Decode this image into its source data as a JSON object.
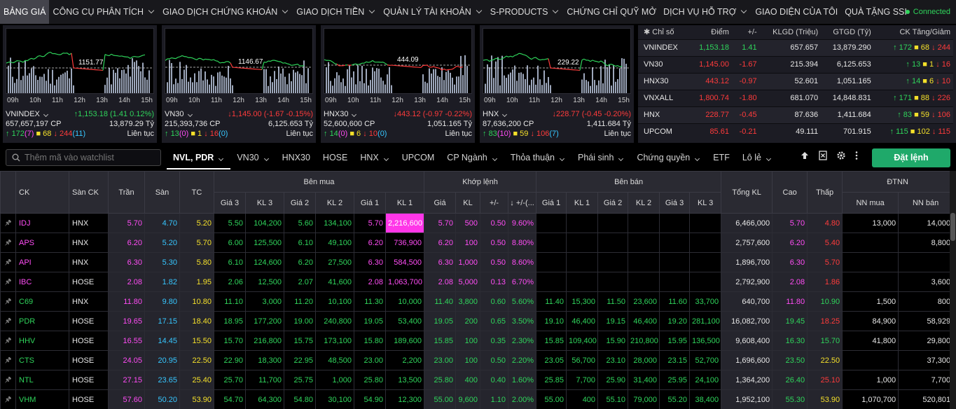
{
  "nav": {
    "items": [
      {
        "label": "BẢNG GIÁ",
        "active": true,
        "chev": false
      },
      {
        "label": "CÔNG CỤ PHÂN TÍCH",
        "chev": true
      },
      {
        "label": "GIAO DỊCH CHỨNG KHOÁN",
        "chev": true
      },
      {
        "label": "GIAO DỊCH TIỀN",
        "chev": true
      },
      {
        "label": "QUẢN LÝ TÀI KHOẢN",
        "chev": true
      },
      {
        "label": "S-PRODUCTS",
        "chev": true
      },
      {
        "label": "CHỨNG CHỈ QUỸ MỞ",
        "chev": false
      },
      {
        "label": "DỊCH VỤ HỖ TRỢ",
        "chev": true
      },
      {
        "label": "GIAO DIỆN CỦA TÔI",
        "chev": false
      },
      {
        "label": "QUÀ TẶNG SSI",
        "chev": false
      }
    ],
    "status": "Connected"
  },
  "xticks": [
    "09h",
    "10h",
    "11h",
    "12h",
    "13h",
    "14h",
    "15h"
  ],
  "panels": [
    {
      "ref_label": "1151.77",
      "name": "VNINDEX",
      "value": "1,153.18",
      "change": "(1.41 0.12%)",
      "dir": "up",
      "volume": "657,657,197 CP",
      "amount": "13,879.29 Tỷ",
      "adv": "172",
      "adv_c": "(7)",
      "nc": "68",
      "dec": "244",
      "dec_c": "(11)",
      "session": "Liên tục"
    },
    {
      "ref_label": "1146.67",
      "name": "VN30",
      "value": "1,145.00",
      "change": "(-1.67 -0.15%)",
      "dir": "dn",
      "volume": "215,393,736 CP",
      "amount": "6,125.653 Tỷ",
      "adv": "13",
      "adv_c": "(0)",
      "nc": "1",
      "dec": "16",
      "dec_c": "(0)",
      "session": "Liên tục"
    },
    {
      "ref_label": "444.09",
      "name": "HNX30",
      "value": "443.12",
      "change": "(-0.97 -0.22%)",
      "dir": "dn",
      "volume": "52,600,600 CP",
      "amount": "1,051.165 Tỷ",
      "adv": "14",
      "adv_c": "(0)",
      "nc": "6",
      "dec": "10",
      "dec_c": "(0)",
      "session": "Liên tục"
    },
    {
      "ref_label": "229.22",
      "name": "HNX",
      "value": "228.77",
      "change": "(-0.45 -0.20%)",
      "dir": "dn",
      "volume": "87,636,200 CP",
      "amount": "1,411.684 Tỷ",
      "adv": "83",
      "adv_c": "(10)",
      "nc": "59",
      "dec": "106",
      "dec_c": "(7)",
      "session": "Liên tục"
    }
  ],
  "index_table": {
    "headers": [
      "Chỉ số",
      "Điểm",
      "+/-",
      "KLGD (Triệu)",
      "GTGD (Tỷ)",
      "CK Tăng/Giảm"
    ],
    "rows": [
      {
        "name": "VNINDEX",
        "point": "1,153.18",
        "chg": "1.41",
        "vol": "657.657",
        "val": "13,879.290",
        "adv": "172",
        "nc": "68",
        "dec": "244",
        "dir": "up"
      },
      {
        "name": "VN30",
        "point": "1,145.00",
        "chg": "-1.67",
        "vol": "215.394",
        "val": "6,125.653",
        "adv": "13",
        "nc": "1",
        "dec": "16",
        "dir": "dn"
      },
      {
        "name": "HNX30",
        "point": "443.12",
        "chg": "-0.97",
        "vol": "52.601",
        "val": "1,051.165",
        "adv": "14",
        "nc": "6",
        "dec": "10",
        "dir": "dn"
      },
      {
        "name": "VNXALL",
        "point": "1,800.74",
        "chg": "-1.80",
        "vol": "681.070",
        "val": "14,848.831",
        "adv": "171",
        "nc": "88",
        "dec": "226",
        "dir": "dn"
      },
      {
        "name": "HNX",
        "point": "228.77",
        "chg": "-0.45",
        "vol": "87.636",
        "val": "1,411.684",
        "adv": "83",
        "nc": "59",
        "dec": "106",
        "dir": "dn"
      },
      {
        "name": "UPCOM",
        "point": "85.61",
        "chg": "-0.21",
        "vol": "49.111",
        "val": "701.915",
        "adv": "115",
        "nc": "102",
        "dec": "115",
        "dir": "dn"
      }
    ]
  },
  "toolbar": {
    "search_placeholder": "Thêm mã vào watchlist",
    "order_label": "Đặt lệnh",
    "tabs": [
      {
        "label": "NVL, PDR",
        "active": true,
        "chev": true
      },
      {
        "label": "VN30",
        "chev": true
      },
      {
        "label": "HNX30"
      },
      {
        "label": "HOSE"
      },
      {
        "label": "HNX",
        "chev": true
      },
      {
        "label": "UPCOM"
      },
      {
        "label": "CP Ngành",
        "chev": true
      },
      {
        "label": "Thỏa thuận",
        "chev": true
      },
      {
        "label": "Phái sinh",
        "chev": true
      },
      {
        "label": "Chứng quyền",
        "chev": true
      },
      {
        "label": "ETF"
      },
      {
        "label": "Lô lẻ",
        "chev": true
      }
    ]
  },
  "board": {
    "groups": {
      "buy": "Bên mua",
      "match": "Khớp lệnh",
      "sell": "Bên bán",
      "foreign": "ĐTNN"
    },
    "h": {
      "ck": "CK",
      "san_ck": "Sàn CK",
      "tran": "Trần",
      "san": "Sàn",
      "tc": "TC",
      "total": "Tổng KL",
      "cao": "Cao",
      "thap": "Thấp"
    },
    "sub": [
      "Giá 3",
      "KL 3",
      "Giá 2",
      "KL 2",
      "Giá 1",
      "KL 1",
      "Giá",
      "KL",
      "+/-",
      "+/-(...",
      "Giá 1",
      "KL 1",
      "Giá 2",
      "KL 2",
      "Giá 3",
      "KL 3",
      "NN mua",
      "NN bán"
    ],
    "rows": [
      {
        "ck": "IDJ",
        "ex": "HNX",
        "ceil": "5.70",
        "floor": "4.70",
        "ref": "5.20",
        "b3": "5.50",
        "bv3": "104,200",
        "b2": "5.60",
        "bv2": "134,100",
        "b1": "5.70",
        "bv1": "2,216,600",
        "mp": "5.70",
        "mv": "500",
        "chg": "0.50",
        "pct": "9.60%",
        "s1": "",
        "sv1": "",
        "s2": "",
        "sv2": "",
        "s3": "",
        "sv3": "",
        "tot": "6,466,000",
        "hi": "5.70",
        "lo": "4.80",
        "nnb": "13,000",
        "nns": "14,000",
        "c": {
          "ck": "ceil",
          "b3": "up",
          "b2": "up",
          "b1": "ceil",
          "bv1": "hl",
          "m": "ceil",
          "hi": "ceil",
          "lo": "dn"
        }
      },
      {
        "ck": "APS",
        "ex": "HNX",
        "ceil": "6.20",
        "floor": "5.20",
        "ref": "5.70",
        "b3": "6.00",
        "bv3": "125,500",
        "b2": "6.10",
        "bv2": "49,100",
        "b1": "6.20",
        "bv1": "736,900",
        "mp": "6.20",
        "mv": "100",
        "chg": "0.50",
        "pct": "8.80%",
        "s1": "",
        "sv1": "",
        "s2": "",
        "sv2": "",
        "s3": "",
        "sv3": "",
        "tot": "2,757,600",
        "hi": "6.20",
        "lo": "5.40",
        "nnb": "",
        "nns": "8,800",
        "c": {
          "ck": "ceil",
          "b3": "up",
          "b2": "up",
          "b1": "ceil",
          "bv1": "ceil",
          "m": "ceil",
          "hi": "ceil",
          "lo": "dn"
        }
      },
      {
        "ck": "API",
        "ex": "HNX",
        "ceil": "6.30",
        "floor": "5.30",
        "ref": "5.80",
        "b3": "6.10",
        "bv3": "124,600",
        "b2": "6.20",
        "bv2": "27,500",
        "b1": "6.30",
        "bv1": "584,500",
        "mp": "6.30",
        "mv": "1,000",
        "chg": "0.50",
        "pct": "8.60%",
        "s1": "",
        "sv1": "",
        "s2": "",
        "sv2": "",
        "s3": "",
        "sv3": "",
        "tot": "1,896,700",
        "hi": "6.30",
        "lo": "5.70",
        "nnb": "",
        "nns": "",
        "c": {
          "ck": "ceil",
          "b3": "up",
          "b2": "up",
          "b1": "ceil",
          "bv1": "ceil",
          "m": "ceil",
          "hi": "ceil",
          "lo": "dn"
        }
      },
      {
        "ck": "IBC",
        "ex": "HOSE",
        "ceil": "2.08",
        "floor": "1.82",
        "ref": "1.95",
        "b3": "2.06",
        "bv3": "12,500",
        "b2": "2.07",
        "bv2": "41,600",
        "b1": "2.08",
        "bv1": "1,063,700",
        "mp": "2.08",
        "mv": "5,000",
        "chg": "0.13",
        "pct": "6.70%",
        "s1": "",
        "sv1": "",
        "s2": "",
        "sv2": "",
        "s3": "",
        "sv3": "",
        "tot": "2,792,900",
        "hi": "2.08",
        "lo": "1.86",
        "nnb": "",
        "nns": "3,600",
        "c": {
          "ck": "ceil",
          "b3": "up",
          "b2": "up",
          "b1": "ceil",
          "bv1": "ceil",
          "m": "ceil",
          "hi": "ceil",
          "lo": "dn"
        }
      },
      {
        "ck": "C69",
        "ex": "HNX",
        "ceil": "11.80",
        "floor": "9.80",
        "ref": "10.80",
        "b3": "11.10",
        "bv3": "3,000",
        "b2": "11.20",
        "bv2": "10,100",
        "b1": "11.30",
        "bv1": "10,000",
        "mp": "11.40",
        "mv": "3,800",
        "chg": "0.60",
        "pct": "5.60%",
        "s1": "11.40",
        "sv1": "15,300",
        "s2": "11.50",
        "sv2": "23,600",
        "s3": "11.60",
        "sv3": "33,700",
        "tot": "640,700",
        "hi": "11.80",
        "lo": "10.90",
        "nnb": "1,500",
        "nns": "800",
        "c": {
          "ck": "up",
          "b3": "up",
          "b2": "up",
          "b1": "up",
          "bv1": "up",
          "m": "up",
          "hi": "ceil",
          "lo": "up"
        }
      },
      {
        "ck": "PDR",
        "ex": "HOSE",
        "ceil": "19.65",
        "floor": "17.15",
        "ref": "18.40",
        "b3": "18.95",
        "bv3": "177,200",
        "b2": "19.00",
        "bv2": "240,800",
        "b1": "19.05",
        "bv1": "53,400",
        "mp": "19.05",
        "mv": "200",
        "chg": "0.65",
        "pct": "3.50%",
        "s1": "19.10",
        "sv1": "46,400",
        "s2": "19.15",
        "sv2": "46,400",
        "s3": "19.20",
        "sv3": "281,100",
        "tot": "16,082,700",
        "hi": "19.45",
        "lo": "18.25",
        "nnb": "84,900",
        "nns": "58,929",
        "c": {
          "ck": "up",
          "b3": "up",
          "b2": "up",
          "b1": "up",
          "bv1": "up",
          "m": "up",
          "hi": "up",
          "lo": "dn"
        }
      },
      {
        "ck": "HHV",
        "ex": "HOSE",
        "ceil": "16.55",
        "floor": "14.45",
        "ref": "15.50",
        "b3": "15.70",
        "bv3": "216,800",
        "b2": "15.75",
        "bv2": "173,100",
        "b1": "15.80",
        "bv1": "189,600",
        "mp": "15.85",
        "mv": "100",
        "chg": "0.35",
        "pct": "2.30%",
        "s1": "15.85",
        "sv1": "109,400",
        "s2": "15.90",
        "sv2": "210,800",
        "s3": "15.95",
        "sv3": "136,500",
        "tot": "9,608,400",
        "hi": "16.30",
        "lo": "15.70",
        "nnb": "41,800",
        "nns": "29,800",
        "c": {
          "ck": "up",
          "b3": "up",
          "b2": "up",
          "b1": "up",
          "bv1": "up",
          "m": "up",
          "hi": "up",
          "lo": "up"
        }
      },
      {
        "ck": "CTS",
        "ex": "HOSE",
        "ceil": "24.05",
        "floor": "20.95",
        "ref": "22.50",
        "b3": "22.90",
        "bv3": "18,300",
        "b2": "22.95",
        "bv2": "48,500",
        "b1": "23.00",
        "bv1": "2,200",
        "mp": "23.00",
        "mv": "100",
        "chg": "0.50",
        "pct": "2.20%",
        "s1": "23.05",
        "sv1": "56,700",
        "s2": "23.10",
        "sv2": "28,000",
        "s3": "23.15",
        "sv3": "52,700",
        "tot": "1,696,600",
        "hi": "23.50",
        "lo": "22.50",
        "nnb": "",
        "nns": "37,300",
        "c": {
          "ck": "up",
          "b3": "up",
          "b2": "up",
          "b1": "up",
          "bv1": "up",
          "m": "up",
          "hi": "up",
          "lo": "ref"
        }
      },
      {
        "ck": "NTL",
        "ex": "HOSE",
        "ceil": "27.15",
        "floor": "23.65",
        "ref": "25.40",
        "b3": "25.70",
        "bv3": "11,700",
        "b2": "25.75",
        "bv2": "1,000",
        "b1": "25.80",
        "bv1": "13,500",
        "mp": "25.80",
        "mv": "400",
        "chg": "0.40",
        "pct": "1.60%",
        "s1": "25.85",
        "sv1": "7,700",
        "s2": "25.90",
        "sv2": "31,400",
        "s3": "25.95",
        "sv3": "24,100",
        "tot": "1,364,200",
        "hi": "26.40",
        "lo": "25.10",
        "nnb": "1,000",
        "nns": "7,700",
        "c": {
          "ck": "up",
          "b3": "up",
          "b2": "up",
          "b1": "up",
          "bv1": "up",
          "m": "up",
          "hi": "up",
          "lo": "dn"
        }
      },
      {
        "ck": "VHM",
        "ex": "HOSE",
        "ceil": "57.60",
        "floor": "50.20",
        "ref": "53.90",
        "b3": "54.70",
        "bv3": "64,300",
        "b2": "54.80",
        "bv2": "30,100",
        "b1": "54.90",
        "bv1": "12,300",
        "mp": "55.00",
        "mv": "9,600",
        "chg": "1.10",
        "pct": "2.00%",
        "s1": "55.00",
        "sv1": "400",
        "s2": "55.10",
        "sv2": "79,000",
        "s3": "55.20",
        "sv3": "38,400",
        "tot": "1,952,100",
        "hi": "55.30",
        "lo": "53.90",
        "nnb": "1,070,700",
        "nns": "520,801",
        "c": {
          "ck": "up",
          "b3": "up",
          "b2": "up",
          "b1": "up",
          "bv1": "up",
          "m": "up",
          "hi": "up",
          "lo": "ref"
        }
      }
    ]
  },
  "colors": {
    "up": "#2fd45b",
    "dn": "#ff3b3b",
    "ref": "#f5e02a",
    "ceil": "#ff4cf5",
    "floor": "#36c6ff",
    "accent": "#1fa96a"
  }
}
